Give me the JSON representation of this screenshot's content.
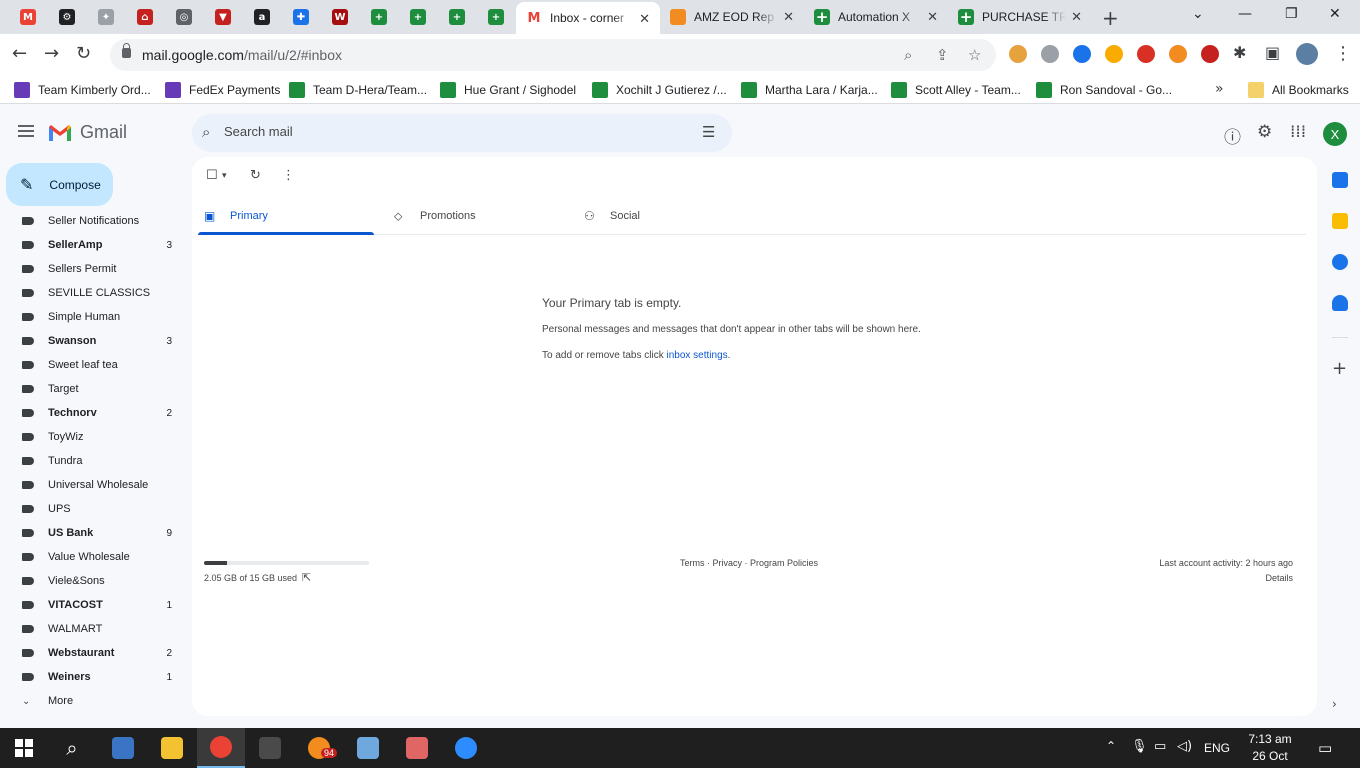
{
  "browser": {
    "pinned_tabs": [
      {
        "icon": "gmail-icon",
        "color": "#ea4335",
        "glyph": "M"
      },
      {
        "icon": "chatgpt-icon",
        "color": "#202124",
        "glyph": "⚙"
      },
      {
        "icon": "app-icon",
        "color": "#9aa0a6",
        "glyph": "✦"
      },
      {
        "icon": "app-icon",
        "color": "#c5221f",
        "glyph": "⌂"
      },
      {
        "icon": "globe-icon",
        "color": "#5f6368",
        "glyph": "◎"
      },
      {
        "icon": "app-icon",
        "color": "#c5221f",
        "glyph": "▼"
      },
      {
        "icon": "amazon-icon",
        "color": "#202124",
        "glyph": "a"
      },
      {
        "icon": "app-icon",
        "color": "#1a73e8",
        "glyph": "✚"
      },
      {
        "icon": "app-icon",
        "color": "#a50e0e",
        "glyph": "W"
      },
      {
        "icon": "sheets-icon",
        "color": "#1e8e3e",
        "glyph": "+"
      },
      {
        "icon": "sheets-icon",
        "color": "#1e8e3e",
        "glyph": "+"
      },
      {
        "icon": "sheets-icon",
        "color": "#1e8e3e",
        "glyph": "+"
      },
      {
        "icon": "sheets-icon",
        "color": "#1e8e3e",
        "glyph": "+"
      }
    ],
    "tabs": [
      {
        "title": "Inbox - corner",
        "active": true,
        "icon": "gmail-icon"
      },
      {
        "title": "AMZ EOD Rep",
        "active": false,
        "icon": "app-icon"
      },
      {
        "title": "Automation X",
        "active": false,
        "icon": "sheets-icon"
      },
      {
        "title": "PURCHASE TR",
        "active": false,
        "icon": "sheets-icon"
      }
    ],
    "url_host": "mail.google.com",
    "url_path": "/mail/u/2/#inbox",
    "bookmarks": [
      {
        "label": "Team Kimberly Ord...",
        "icon": "forms"
      },
      {
        "label": "FedEx Payments",
        "icon": "fedex"
      },
      {
        "label": "Team D-Hera/Team...",
        "icon": "sheet"
      },
      {
        "label": "Hue Grant / Sighodel",
        "icon": "sheet"
      },
      {
        "label": "Xochilt J Gutierez /...",
        "icon": "sheet"
      },
      {
        "label": "Martha Lara / Karja...",
        "icon": "sheet"
      },
      {
        "label": "Scott Alley - Team...",
        "icon": "sheet"
      },
      {
        "label": "Ron Sandoval - Go...",
        "icon": "sheet"
      }
    ],
    "all_bookmarks": "All Bookmarks"
  },
  "gmail": {
    "logo_text": "Gmail",
    "search_placeholder": "Search mail",
    "avatar_initial": "X",
    "compose_label": "Compose",
    "labels": [
      {
        "name": "Seller Notifications",
        "bold": false,
        "count": ""
      },
      {
        "name": "SellerAmp",
        "bold": true,
        "count": "3"
      },
      {
        "name": "Sellers Permit",
        "bold": false,
        "count": ""
      },
      {
        "name": "SEVILLE CLASSICS",
        "bold": false,
        "count": ""
      },
      {
        "name": "Simple Human",
        "bold": false,
        "count": ""
      },
      {
        "name": "Swanson",
        "bold": true,
        "count": "3"
      },
      {
        "name": "Sweet leaf tea",
        "bold": false,
        "count": ""
      },
      {
        "name": "Target",
        "bold": false,
        "count": ""
      },
      {
        "name": "Technorv",
        "bold": true,
        "count": "2"
      },
      {
        "name": "ToyWiz",
        "bold": false,
        "count": ""
      },
      {
        "name": "Tundra",
        "bold": false,
        "count": ""
      },
      {
        "name": "Universal Wholesale",
        "bold": false,
        "count": ""
      },
      {
        "name": "UPS",
        "bold": false,
        "count": ""
      },
      {
        "name": "US Bank",
        "bold": true,
        "count": "9"
      },
      {
        "name": "Value Wholesale",
        "bold": false,
        "count": ""
      },
      {
        "name": "Viele&Sons",
        "bold": false,
        "count": ""
      },
      {
        "name": "VITACOST",
        "bold": true,
        "count": "1"
      },
      {
        "name": "WALMART",
        "bold": false,
        "count": ""
      },
      {
        "name": "Webstaurant",
        "bold": true,
        "count": "2"
      },
      {
        "name": "Weiners",
        "bold": true,
        "count": "1"
      }
    ],
    "more_label": "More",
    "category_tabs": [
      {
        "label": "Primary",
        "icon": "inbox-icon",
        "active": true
      },
      {
        "label": "Promotions",
        "icon": "tag-icon",
        "active": false
      },
      {
        "label": "Social",
        "icon": "people-icon",
        "active": false
      }
    ],
    "empty": {
      "title": "Your Primary tab is empty.",
      "desc": "Personal messages and messages that don't appear in other tabs will be shown here.",
      "hint_prefix": "To add or remove tabs click ",
      "hint_link": "inbox settings",
      "hint_suffix": "."
    },
    "storage": {
      "text": "2.05 GB of 15 GB used",
      "used_fraction": 0.137
    },
    "footer_links": "Terms · Privacy · Program Policies",
    "last_activity": "Last account activity: 2 hours ago",
    "details": "Details"
  },
  "taskbar": {
    "apps": [
      {
        "name": "file-explorer-app",
        "color": "#3b73c5"
      },
      {
        "name": "folder-app",
        "color": "#f2c230"
      },
      {
        "name": "chrome-app",
        "color": "#ea4335",
        "active": true
      },
      {
        "name": "calculator-app",
        "color": "#4a4a4a"
      },
      {
        "name": "telegram-app",
        "color": "#f28c1e",
        "badge": "94"
      },
      {
        "name": "paint-app",
        "color": "#6fa8dc"
      },
      {
        "name": "snipping-tool-app",
        "color": "#e06666"
      },
      {
        "name": "zoom-app",
        "color": "#2d8cff"
      }
    ],
    "language": "ENG",
    "time": "7:13 am",
    "date": "26 Oct 2023"
  }
}
